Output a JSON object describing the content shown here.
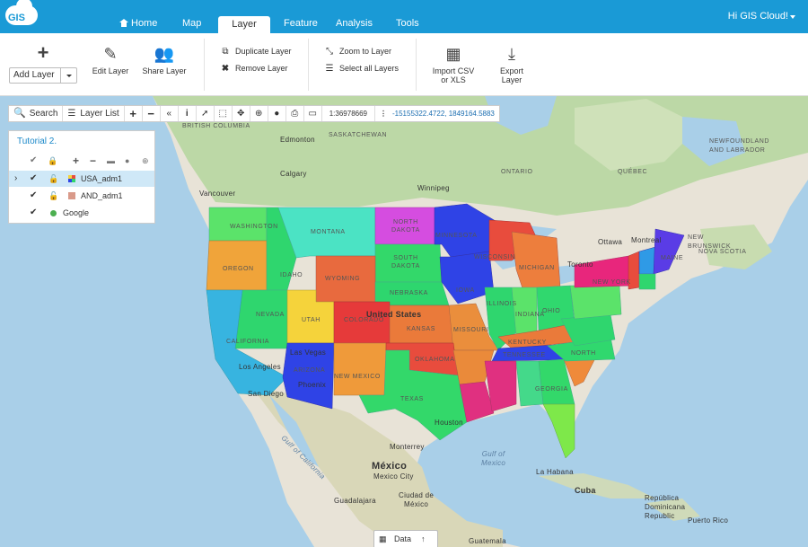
{
  "app": {
    "logo_text": "GIS",
    "greeting": "Hi GIS Cloud!"
  },
  "nav": {
    "tabs": [
      {
        "label": "Home"
      },
      {
        "label": "Map"
      },
      {
        "label": "Layer"
      },
      {
        "label": "Feature"
      },
      {
        "label": "Analysis"
      },
      {
        "label": "Tools"
      }
    ],
    "active": "Layer"
  },
  "ribbon": {
    "add_layer": "Add Layer",
    "edit_layer": "Edit Layer",
    "share_layer": "Share Layer",
    "duplicate_layer": "Duplicate Layer",
    "remove_layer": "Remove Layer",
    "zoom_to_layer": "Zoom to Layer",
    "select_all_layers": "Select all Layers",
    "import_csv_1": "Import CSV",
    "import_csv_2": "or XLS",
    "export_layer_1": "Export",
    "export_layer_2": "Layer"
  },
  "toolbar": {
    "search": "Search",
    "layer_list": "Layer List",
    "scale": "1:36978669",
    "coords": "-15155322.4722, 1849164.5883"
  },
  "layers": {
    "map_title": "Tutorial 2.",
    "items": [
      {
        "name": "USA_adm1",
        "color": "#e84c3d"
      },
      {
        "name": "AND_adm1",
        "color": "#d99a8a"
      },
      {
        "name": "Google",
        "color": "#4caf50"
      }
    ]
  },
  "map_labels": {
    "british_columbia": "BRITISH COLUMBIA",
    "edmonton": "Edmonton",
    "saskatchewan": "SASKATCHEWAN",
    "calgary": "Calgary",
    "ontario": "ONTARIO",
    "quebec": "QUÉBEC",
    "newfoundland": "NEWFOUNDLAND AND LABRADOR",
    "vancouver": "Vancouver",
    "winnipeg": "Winnipeg",
    "ottawa": "Ottawa",
    "montreal": "Montreal",
    "new_brunswick": "NEW BRUNSWICK",
    "nova_scotia": "NOVA SCOTIA",
    "toronto": "Toronto",
    "us": "United States",
    "los_angeles": "Los Angeles",
    "san_diego": "San Diego",
    "las_vegas": "Las Vegas",
    "phoenix": "Phoenix",
    "houston": "Houston",
    "gulf_ca": "Gulf of California",
    "gulf_mx_1": "Gulf of",
    "gulf_mx_2": "Mexico",
    "mexico": "México",
    "monterrey": "Monterrey",
    "mexico_city": "Mexico City",
    "guadalajara": "Guadalajara",
    "ciudad_mx_1": "Ciudad de",
    "ciudad_mx_2": "México",
    "la_habana": "La Habana",
    "cuba": "Cuba",
    "dominican_1": "República",
    "dominican_2": "Dominicana",
    "dominican_3": "Republic",
    "puerto_rico": "Puerto Rico",
    "guatemala": "Guatemala",
    "washington": "WASHINGTON",
    "montana": "MONTANA",
    "north_dakota_1": "NORTH",
    "north_dakota_2": "DAKOTA",
    "south_dakota_1": "SOUTH",
    "south_dakota_2": "DAKOTA",
    "oregon": "OREGON",
    "idaho": "IDAHO",
    "wyoming": "WYOMING",
    "nebraska": "NEBRASKA",
    "iowa": "IOWA",
    "nevada": "NEVADA",
    "utah": "UTAH",
    "colorado": "COLORADO",
    "kansas": "KANSAS",
    "missouri": "MISSOURI",
    "california": "CALIFORNIA",
    "arizona": "ARIZONA",
    "new_mexico": "NEW MEXICO",
    "oklahoma": "OKLAHOMA",
    "texas": "TEXAS",
    "minnesota": "MINNESOTA",
    "wisconsin": "WISCONSIN",
    "michigan": "MICHIGAN",
    "illinois": "ILLINOIS",
    "indiana": "INDIANA",
    "ohio": "OHIO",
    "kentucky": "KENTUCKY",
    "tennessee": "TENNESSEE",
    "north_carolina": "NORTH",
    "georgia": "GEORGIA",
    "new_york": "NEW YORK",
    "maine": "MAINE"
  },
  "datatab": {
    "label": "Data"
  }
}
